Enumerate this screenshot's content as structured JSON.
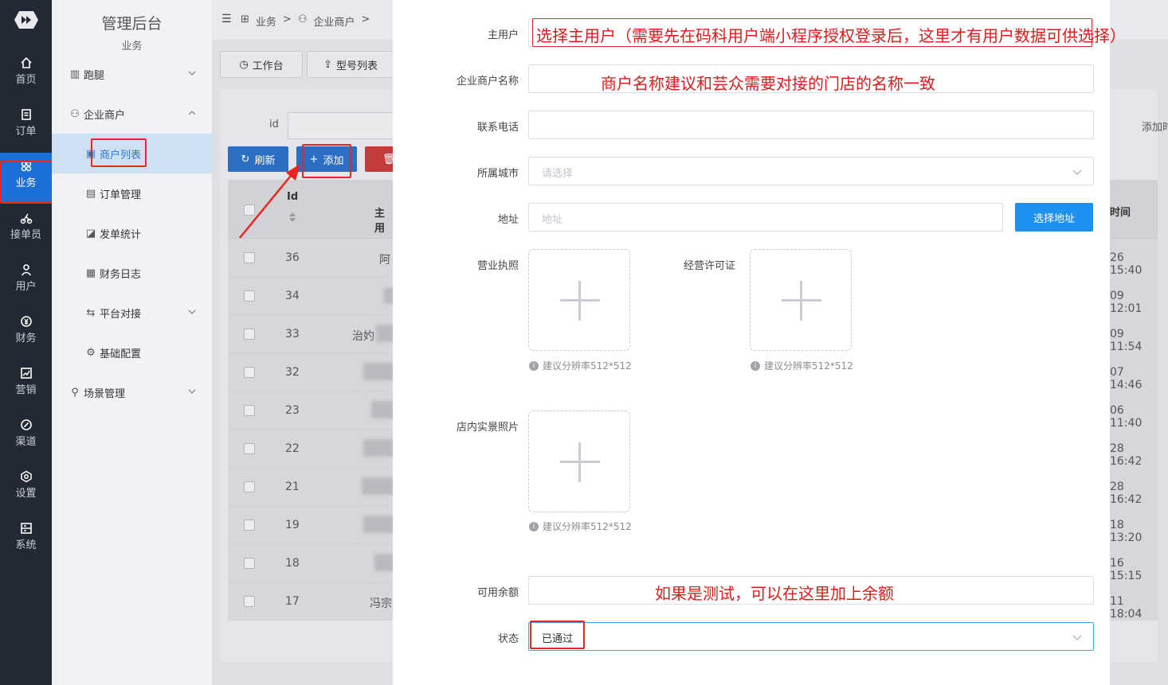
{
  "left_nav": {
    "items": [
      {
        "label": "首页",
        "icon": "home-icon"
      },
      {
        "label": "订单",
        "icon": "order-icon"
      },
      {
        "label": "业务",
        "icon": "business-icon",
        "active": true
      },
      {
        "label": "接单员",
        "icon": "courier-icon"
      },
      {
        "label": "用户",
        "icon": "user-icon"
      },
      {
        "label": "财务",
        "icon": "finance-icon"
      },
      {
        "label": "营销",
        "icon": "marketing-icon"
      },
      {
        "label": "渠道",
        "icon": "channel-icon"
      },
      {
        "label": "设置",
        "icon": "settings-icon"
      },
      {
        "label": "系统",
        "icon": "system-icon"
      }
    ]
  },
  "sidebar": {
    "title": "管理后台",
    "section": "业务",
    "items": [
      {
        "label": "跑腿",
        "icon": "errand-icon"
      },
      {
        "label": "企业商户",
        "icon": "merchant-icon"
      },
      {
        "label": "商户列表",
        "icon": "list-icon"
      },
      {
        "label": "订单管理",
        "icon": "order-manage-icon"
      },
      {
        "label": "发单统计",
        "icon": "stats-icon"
      },
      {
        "label": "财务日志",
        "icon": "log-icon"
      },
      {
        "label": "平台对接",
        "icon": "exchange-icon"
      },
      {
        "label": "基础配置",
        "icon": "config-icon"
      },
      {
        "label": "场景管理",
        "icon": "scene-icon"
      }
    ]
  },
  "breadcrumb": {
    "items": [
      "业务",
      "企业商户"
    ],
    "sep": ">"
  },
  "tabs": {
    "workbench": "工作台",
    "model_list": "型号列表"
  },
  "filter": {
    "id_label": "id",
    "right_label": "添加时"
  },
  "toolbar": {
    "refresh": "刷新",
    "add": "添加"
  },
  "table": {
    "headers": {
      "id": "Id",
      "main_user": "主用",
      "time": "时间"
    },
    "rows": [
      {
        "id": "36",
        "name": "阿",
        "time": "26 15:40"
      },
      {
        "id": "34",
        "name": "",
        "time": "09 12:01"
      },
      {
        "id": "33",
        "name": "治妁",
        "time": "09 11:54"
      },
      {
        "id": "32",
        "name": "",
        "time": "07 14:46"
      },
      {
        "id": "23",
        "name": "",
        "time": "06 11:40"
      },
      {
        "id": "22",
        "name": "",
        "time": "28 16:42"
      },
      {
        "id": "21",
        "name": "",
        "time": "28 16:42"
      },
      {
        "id": "19",
        "name": "",
        "time": "18 13:20"
      },
      {
        "id": "18",
        "name": "",
        "time": "16 15:15"
      },
      {
        "id": "17",
        "name": "冯宗",
        "time": "11 18:04"
      }
    ]
  },
  "form": {
    "main_user_label": "主用户",
    "main_user_note": "选择主用户（需要先在码科用户端小程序授权登录后，这里才有用户数据可供选择）",
    "merchant_name_label": "企业商户名称",
    "merchant_name_note": "商户名称建议和芸众需要对接的门店的名称一致",
    "phone_label": "联系电话",
    "city_label": "所属城市",
    "city_placeholder": "请选择",
    "address_label": "地址",
    "address_placeholder": "地址",
    "choose_address": "选择地址",
    "license_label": "营业执照",
    "permit_label": "经营许可证",
    "photo_label": "店内实景照片",
    "hint": "建议分辨率512*512",
    "balance_label": "可用余额",
    "balance_note": "如果是测试，可以在这里加上余额",
    "status_label": "状态",
    "status_value": "已通过"
  },
  "colors": {
    "nav_bg": "#222834",
    "accent": "#1d6fd8",
    "annotation": "#e21a1a",
    "danger": "#d33b3b"
  }
}
